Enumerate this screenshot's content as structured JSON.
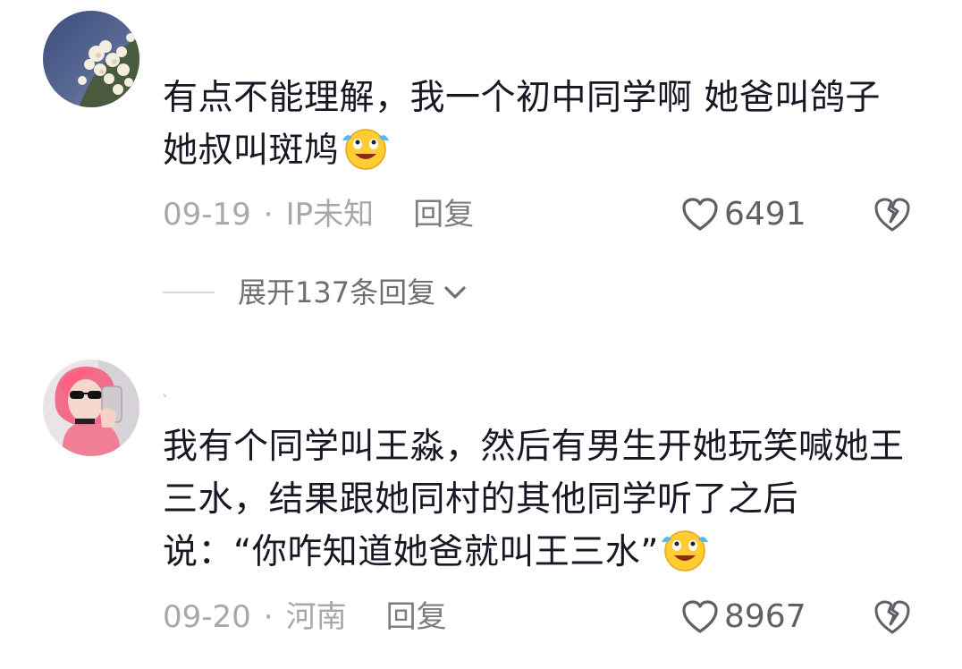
{
  "comments": [
    {
      "text": "有点不能理解，我一个初中同学啊 她爸叫鸽子 她叔叫斑鸠",
      "date": "09-19",
      "location": "IP未知",
      "reply_label": "回复",
      "likes": "6491",
      "expand_label": "展开137条回复",
      "emoji": "crying-laughing-emoji"
    },
    {
      "username": "、",
      "text": "我有个同学叫王淼，然后有男生开她玩笑喊她王三水，结果跟她同村的其他同学听了之后说：“你咋知道她爸就叫王三水”",
      "date": "09-20",
      "location": "河南",
      "reply_label": "回复",
      "likes": "8967",
      "emoji": "crying-laughing-emoji"
    }
  ],
  "meta_separator": "·",
  "colors": {
    "text": "#161823",
    "meta": "#a7a7ad",
    "reply": "#7c7c83",
    "likes": "#5f5f66"
  }
}
